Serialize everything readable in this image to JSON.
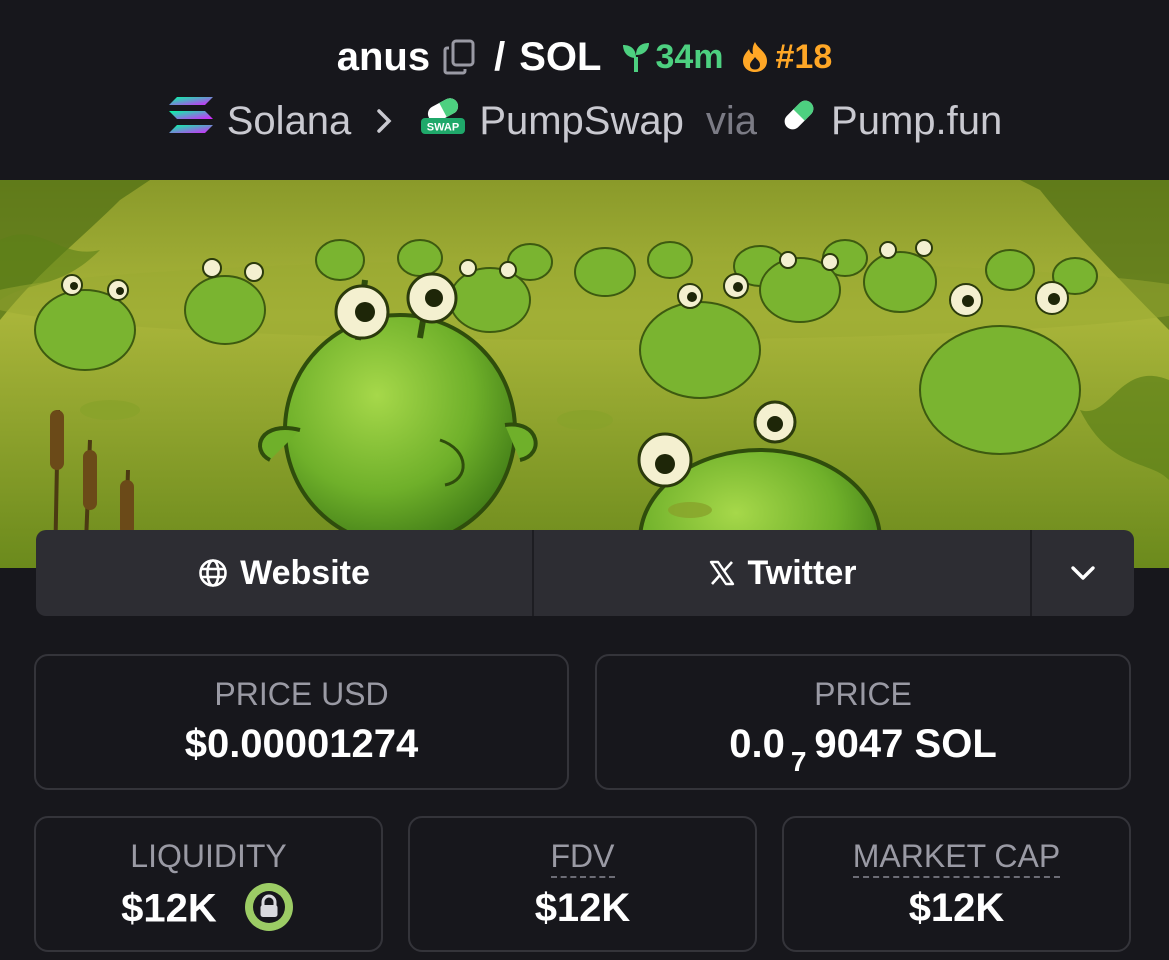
{
  "header": {
    "token_symbol": "anus",
    "separator": "/",
    "quote_symbol": "SOL",
    "age": "34m",
    "trending_rank": "#18",
    "icons": [
      "copy-icon",
      "seedling-icon",
      "flame-icon"
    ]
  },
  "breadcrumb": {
    "chain": "Solana",
    "dex": "PumpSwap",
    "dex_badge": "SWAP",
    "via_label": "via",
    "launchpad": "Pump.fun",
    "icons": [
      "solana-logo-icon",
      "chevron-right-icon",
      "pumpswap-logo-icon",
      "pill-icon"
    ]
  },
  "banner": {
    "description_icon": "token-banner-image"
  },
  "links": {
    "website_label": "Website",
    "twitter_label": "Twitter",
    "icons": [
      "globe-icon",
      "x-logo-icon",
      "chevron-down-icon"
    ]
  },
  "stats": {
    "price_usd": {
      "label": "PRICE USD",
      "value": "$0.00001274"
    },
    "price_native": {
      "label": "PRICE",
      "prefix": "0.0",
      "zero_count": "7",
      "digits": "9047",
      "unit": "SOL"
    },
    "liquidity": {
      "label": "LIQUIDITY",
      "value": "$12K",
      "icon": "lock-icon"
    },
    "fdv": {
      "label": "FDV",
      "value": "$12K"
    },
    "market_cap": {
      "label": "MARKET CAP",
      "value": "$12K"
    }
  },
  "colors": {
    "background": "#17171c",
    "age_green": "#4dd080",
    "rank_orange": "#ffa726",
    "card_border": "#34343a",
    "link_bar": "#2d2d33",
    "lock_green": "#9ccc65"
  }
}
